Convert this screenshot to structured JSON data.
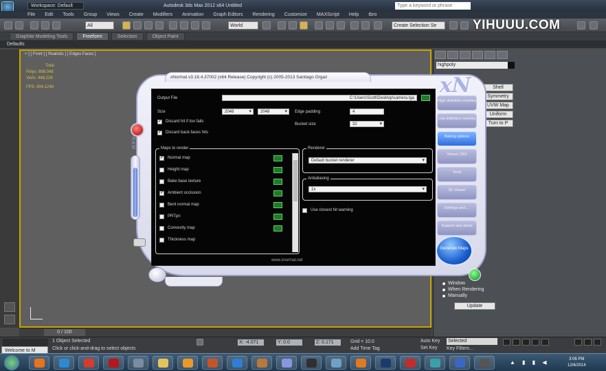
{
  "title_bar": {
    "workspace": "Workspace: Default",
    "title": "Autodesk 3ds Max  2012 x64      Untitled",
    "search_placeholder": "Type a keyword or phrase"
  },
  "menu": [
    "File",
    "Edit",
    "Tools",
    "Group",
    "Views",
    "Create",
    "Modifiers",
    "Animation",
    "Graph Editors",
    "Rendering",
    "Customize",
    "MAXScript",
    "Help",
    "tbro"
  ],
  "toolbar": {
    "filter": "All",
    "refcoord": "World",
    "named_selection": "Create Selection Se"
  },
  "watermark": "YIHUUU.COM",
  "ribbon_tabs": [
    "Graphite Modeling Tools",
    "Freeform",
    "Selection",
    "Object Paint"
  ],
  "ribbon_defaults": "Defaults",
  "viewport": {
    "label": "+ ] [ Front ] [ Realistic ] [ Edges Faces ]",
    "stats": [
      "Polys:",
      "Total",
      "Verts:",
      "FPS:"
    ],
    "stat_values": [
      "",
      "898,048",
      "448,228",
      "404.1246"
    ]
  },
  "timeline": {
    "frames": "0 / 100"
  },
  "command_panel": {
    "name": "highpoly",
    "buttons": [
      "Shell",
      "Symmetry",
      "UVW Map",
      "Uniform [UVW]",
      "Turn to P"
    ],
    "radios": [
      "Window",
      "When Rendering",
      "Manually"
    ],
    "bake_button": "Update"
  },
  "status": {
    "selected": "1 Object Selected",
    "hint": "Click or click-and-drag to select objects",
    "welcome": "Welcome to M",
    "x": "X: -4.071",
    "y": "Y: 0.0",
    "z": "Z: 0.171",
    "grid": "Grid = 10.0",
    "add_time_tag": "Add Time Tag",
    "auto_key": "Auto Key",
    "set_key": "Set Key",
    "selected_dd": "Selected",
    "key_filters": "Key Filters..."
  },
  "xnormal": {
    "title": "xNormal v3.18.4.37002 (x64 Release) Copyright (c) 2005-2013 Santiago Orgaz",
    "ram_label": "RAM",
    "output_label": "Output File",
    "output_path": "C:\\Users\\Scott\\Desktop\\camera.tga",
    "size_label": "Size",
    "size_w": "2048",
    "size_h": "2048",
    "edge_padding_label": "Edge padding",
    "edge_padding": "4",
    "bucket_label": "Bucket size",
    "bucket": "32",
    "discard_ray_label": "Discard hit if too fails",
    "discard_backface_label": "Discard back-faces hits",
    "maps_title": "Maps to render",
    "maps": [
      {
        "label": "Normal map",
        "checked": true
      },
      {
        "label": "Height map",
        "checked": false
      },
      {
        "label": "Bake base texture",
        "checked": false
      },
      {
        "label": "Ambient occlusion",
        "checked": true
      },
      {
        "label": "Bent normal map",
        "checked": false
      },
      {
        "label": "PRTpn",
        "checked": false
      },
      {
        "label": "Convexity map",
        "checked": false
      },
      {
        "label": "Thickness map",
        "checked": false
      }
    ],
    "renderer_title": "Renderer",
    "renderer": "Default bucket renderer",
    "antialias_title": "Antialiasing",
    "antialias": "1x",
    "closest_hit_label": "Use closest hit warning",
    "footer": "www.xnormal.net",
    "side_buttons": [
      "High definition meshes",
      "Low definition meshes",
      "Baking options",
      "Viewer (3D)",
      "Tools",
      "3D Viewer",
      "Settings and ...",
      "Support and about"
    ],
    "generate_button": "Generate Maps"
  },
  "taskbar": {
    "clock_time": "3:06 PM",
    "clock_date": "12/6/2014"
  }
}
